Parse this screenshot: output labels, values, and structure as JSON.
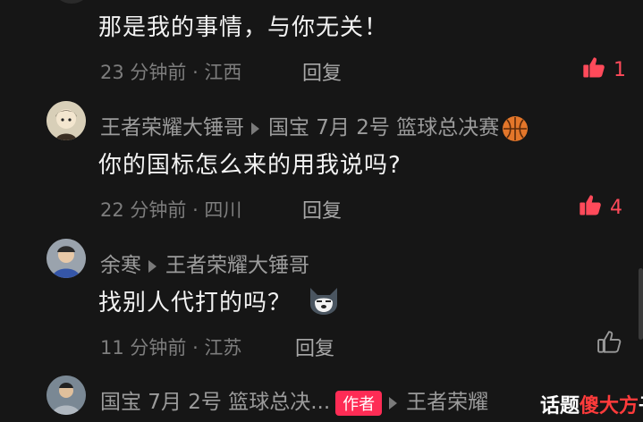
{
  "comments": [
    {
      "text": "那是我的事情，与你无关！",
      "time": "23 分钟前 · 江西",
      "reply_label": "回复",
      "likes": "1",
      "liked": true
    },
    {
      "username": "王者荣耀大锤哥",
      "reply_to": "国宝 7月 2号 篮球总决赛",
      "text": "你的国标怎么来的用我说吗?",
      "time": "22 分钟前 · 四川",
      "reply_label": "回复",
      "likes": "4",
      "liked": true
    },
    {
      "username": "余寒",
      "reply_to": "王者荣耀大锤哥",
      "text": "找别人代打的吗？",
      "time": "11 分钟前 · 江苏",
      "reply_label": "回复",
      "likes": "",
      "liked": false
    },
    {
      "username": "国宝 7月 2号 篮球总决...",
      "author_badge": "作者",
      "reply_to": "王者荣耀"
    }
  ],
  "watermark": {
    "part1": "话题",
    "part2": "傻大方",
    "part3": "子"
  },
  "icons": {
    "like": "thumbs-up-icon",
    "reply_arrow": "reply-arrow-icon",
    "basketball": "basketball-icon"
  },
  "colors": {
    "background": "#161616",
    "like_active": "#ff4a5a",
    "author_badge": "#fe2c55"
  }
}
